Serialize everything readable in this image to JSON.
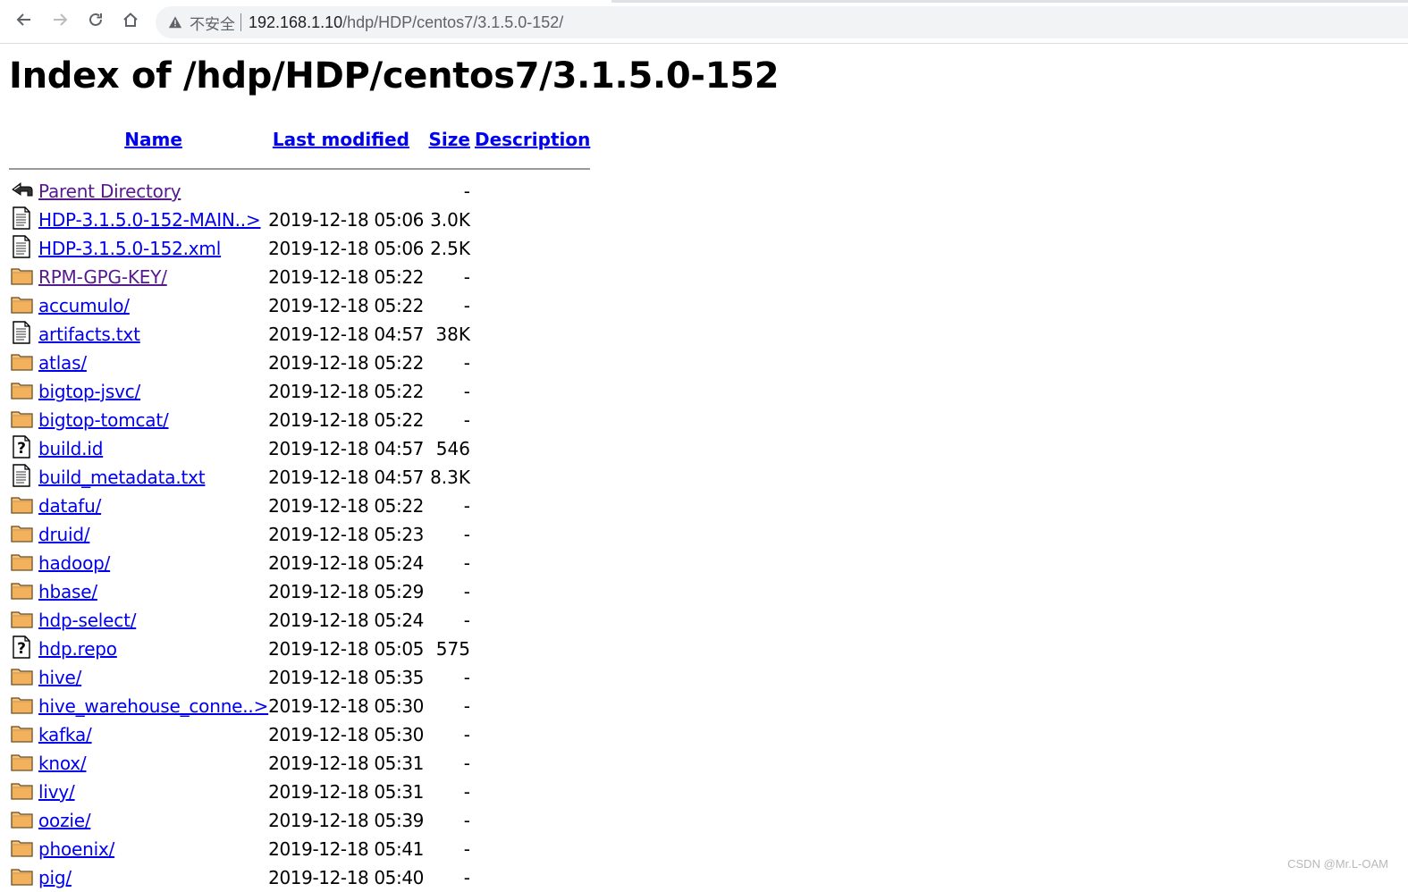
{
  "browser": {
    "security_label": "不安全",
    "url_host": "192.168.1.10",
    "url_path": "/hdp/HDP/centos7/3.1.5.0-152/"
  },
  "page": {
    "title": "Index of /hdp/HDP/centos7/3.1.5.0-152",
    "columns": {
      "name": "Name",
      "last_modified": "Last modified",
      "size": "Size",
      "description": "Description"
    },
    "entries": [
      {
        "icon": "back-icon",
        "name": "Parent Directory",
        "modified": "",
        "size": "-",
        "visited": true
      },
      {
        "icon": "text-file-icon",
        "name": "HDP-3.1.5.0-152-MAIN..>",
        "modified": "2019-12-18 05:06",
        "size": "3.0K",
        "visited": false
      },
      {
        "icon": "text-file-icon",
        "name": "HDP-3.1.5.0-152.xml",
        "modified": "2019-12-18 05:06",
        "size": "2.5K",
        "visited": false
      },
      {
        "icon": "folder-icon",
        "name": "RPM-GPG-KEY/",
        "modified": "2019-12-18 05:22",
        "size": "-",
        "visited": true
      },
      {
        "icon": "folder-icon",
        "name": "accumulo/",
        "modified": "2019-12-18 05:22",
        "size": "-",
        "visited": false
      },
      {
        "icon": "text-file-icon",
        "name": "artifacts.txt",
        "modified": "2019-12-18 04:57",
        "size": "38K",
        "visited": false
      },
      {
        "icon": "folder-icon",
        "name": "atlas/",
        "modified": "2019-12-18 05:22",
        "size": "-",
        "visited": false
      },
      {
        "icon": "folder-icon",
        "name": "bigtop-jsvc/",
        "modified": "2019-12-18 05:22",
        "size": "-",
        "visited": false
      },
      {
        "icon": "folder-icon",
        "name": "bigtop-tomcat/",
        "modified": "2019-12-18 05:22",
        "size": "-",
        "visited": false
      },
      {
        "icon": "unknown-file-icon",
        "name": "build.id",
        "modified": "2019-12-18 04:57",
        "size": "546",
        "visited": false
      },
      {
        "icon": "text-file-icon",
        "name": "build_metadata.txt",
        "modified": "2019-12-18 04:57",
        "size": "8.3K",
        "visited": false
      },
      {
        "icon": "folder-icon",
        "name": "datafu/",
        "modified": "2019-12-18 05:22",
        "size": "-",
        "visited": false
      },
      {
        "icon": "folder-icon",
        "name": "druid/",
        "modified": "2019-12-18 05:23",
        "size": "-",
        "visited": false
      },
      {
        "icon": "folder-icon",
        "name": "hadoop/",
        "modified": "2019-12-18 05:24",
        "size": "-",
        "visited": false
      },
      {
        "icon": "folder-icon",
        "name": "hbase/",
        "modified": "2019-12-18 05:29",
        "size": "-",
        "visited": false
      },
      {
        "icon": "folder-icon",
        "name": "hdp-select/",
        "modified": "2019-12-18 05:24",
        "size": "-",
        "visited": false
      },
      {
        "icon": "unknown-file-icon",
        "name": "hdp.repo",
        "modified": "2019-12-18 05:05",
        "size": "575",
        "visited": false
      },
      {
        "icon": "folder-icon",
        "name": "hive/",
        "modified": "2019-12-18 05:35",
        "size": "-",
        "visited": false
      },
      {
        "icon": "folder-icon",
        "name": "hive_warehouse_conne..>",
        "modified": "2019-12-18 05:30",
        "size": "-",
        "visited": false
      },
      {
        "icon": "folder-icon",
        "name": "kafka/",
        "modified": "2019-12-18 05:30",
        "size": "-",
        "visited": false
      },
      {
        "icon": "folder-icon",
        "name": "knox/",
        "modified": "2019-12-18 05:31",
        "size": "-",
        "visited": false
      },
      {
        "icon": "folder-icon",
        "name": "livy/",
        "modified": "2019-12-18 05:31",
        "size": "-",
        "visited": false
      },
      {
        "icon": "folder-icon",
        "name": "oozie/",
        "modified": "2019-12-18 05:39",
        "size": "-",
        "visited": false
      },
      {
        "icon": "folder-icon",
        "name": "phoenix/",
        "modified": "2019-12-18 05:41",
        "size": "-",
        "visited": false
      },
      {
        "icon": "folder-icon",
        "name": "pig/",
        "modified": "2019-12-18 05:40",
        "size": "-",
        "visited": false
      }
    ]
  },
  "watermark": "CSDN @Mr.L-OAM"
}
